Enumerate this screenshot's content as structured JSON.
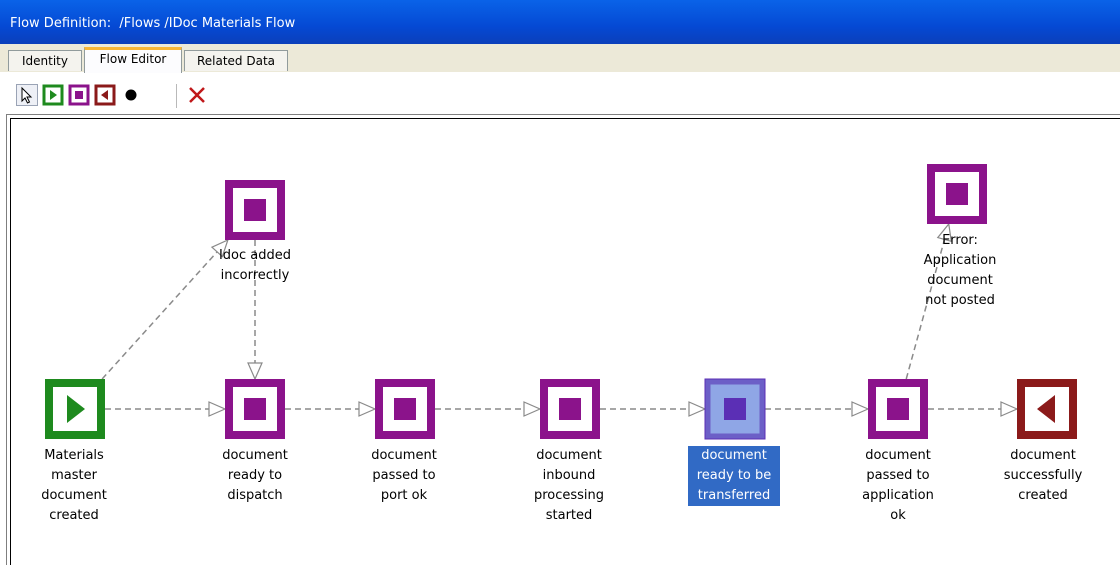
{
  "window": {
    "title": "Flow Definition:  /Flows /IDoc Materials Flow"
  },
  "tabs": [
    {
      "label": "Identity",
      "active": false
    },
    {
      "label": "Flow Editor",
      "active": true
    },
    {
      "label": "Related Data",
      "active": false
    }
  ],
  "toolbar": {
    "tools": [
      "pointer-icon",
      "start-state-icon",
      "intermediate-state-icon",
      "end-state-icon",
      "junction-dot-icon",
      "delete-icon"
    ]
  },
  "colors": {
    "start": "#1e8a1e",
    "intermediate": "#8b138b",
    "end": "#8b1a1a",
    "selected_fill": "#8fa6e6",
    "selected_inner": "#5b2fb5",
    "selection": "#316ac5",
    "title_bar": "#0549d4"
  },
  "nodes": [
    {
      "id": "n_start",
      "kind": "start",
      "label_lines": [
        "Materials",
        "master",
        "document",
        "created"
      ]
    },
    {
      "id": "n_dispatch",
      "kind": "intermediate",
      "label_lines": [
        "document",
        "ready to",
        "dispatch"
      ]
    },
    {
      "id": "n_port",
      "kind": "intermediate",
      "label_lines": [
        "document",
        "passed to",
        "port ok"
      ]
    },
    {
      "id": "n_inbound",
      "kind": "intermediate",
      "label_lines": [
        "document",
        "inbound",
        "processing",
        "started"
      ]
    },
    {
      "id": "n_transfer",
      "kind": "intermediate",
      "selected": true,
      "label_lines": [
        "document",
        "ready to be",
        "transferred"
      ]
    },
    {
      "id": "n_application",
      "kind": "intermediate",
      "label_lines": [
        "document",
        "passed to",
        "application",
        "ok"
      ]
    },
    {
      "id": "n_end",
      "kind": "end",
      "label_lines": [
        "document",
        "successfully",
        "created"
      ]
    },
    {
      "id": "n_idoc",
      "kind": "intermediate",
      "label_lines": [
        "Idoc added",
        "incorrectly"
      ]
    },
    {
      "id": "n_error",
      "kind": "intermediate",
      "label_lines": [
        "Error:",
        "Application",
        "document",
        "not posted"
      ]
    }
  ],
  "edges": [
    {
      "from": "n_start",
      "to": "n_dispatch"
    },
    {
      "from": "n_dispatch",
      "to": "n_port"
    },
    {
      "from": "n_port",
      "to": "n_inbound"
    },
    {
      "from": "n_inbound",
      "to": "n_transfer"
    },
    {
      "from": "n_transfer",
      "to": "n_application"
    },
    {
      "from": "n_application",
      "to": "n_end"
    },
    {
      "from": "n_start",
      "to": "n_idoc"
    },
    {
      "from": "n_idoc",
      "to": "n_dispatch"
    },
    {
      "from": "n_application",
      "to": "n_error"
    }
  ]
}
